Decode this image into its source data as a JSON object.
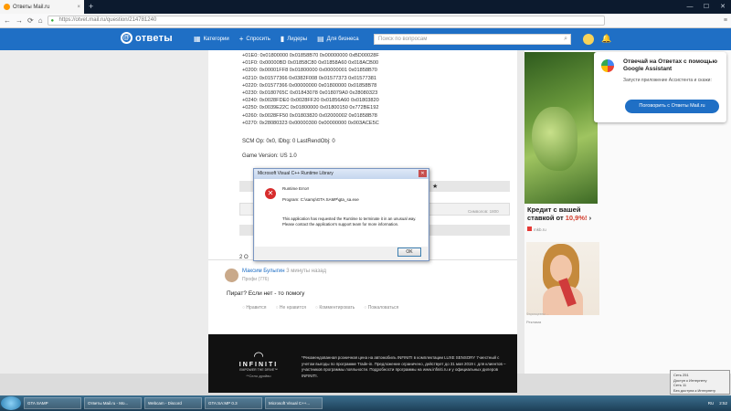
{
  "browser": {
    "tab_title": "Ответы Mail.ru",
    "tab_close": "×",
    "new_tab": "+",
    "url": "https://otvet.mail.ru/question/214781240",
    "win_min": "—",
    "win_max": "☐",
    "win_close": "✕",
    "back": "←",
    "forward": "→",
    "reload": "⟳",
    "home": "⌂",
    "menu": "≡"
  },
  "site": {
    "logo_text": "ответы",
    "menu": [
      {
        "icon": "▦",
        "label": "Категории"
      },
      {
        "icon": "+",
        "label": "Спросить"
      },
      {
        "icon": "▮",
        "label": "Лидеры"
      },
      {
        "icon": "▤",
        "label": "Для бизнеса"
      }
    ],
    "search_placeholder": "Поиск по вопросам",
    "bell": "🔔"
  },
  "question": {
    "dump_lines": [
      "+01E0: 0x01800000 0x01858B70 0x00000000 0xBD00028F",
      "+01F0: 0x00000BD 0x01858C80 0x01858A60 0x018ACB00",
      "+0200: 0x00001FF8 0x01800000 0x00000001 0x01858B70",
      "+0210: 0x01577366 0x0382F008 0x01577373 0x01577381",
      "+0220: 0x01577366 0x00000000 0x01800000 0x01858B78",
      "+0230: 0x0180765C 0x01843078 0x018079A0 0x28080323",
      "+0240: 0x0028FDE0 0x0028FF20 0x01856A60 0x01803820",
      "+0250: 0x0039E22C 0x01800000 0x01800150 0x772BE192",
      "+0260: 0x0028FF50 0x01803820 0x02000002 0x01858B78",
      "+0270: 0x28080323 0x00000300 0x00000000 0x003ACE5C"
    ],
    "scm": "SCM Op: 0x0, lDbg: 0 LastRendObj: 0",
    "game_version": "Game Version: US 1.0",
    "star": "★",
    "counter": "Символов: 1800",
    "answers_count": "2 О"
  },
  "answer": {
    "author": "Максим Булыгин",
    "time": "3 минуты назад",
    "rank": "Профи (776)",
    "text": "Пират? Если нет - то помогу",
    "actions": [
      "Нравится",
      "Не нравится",
      "Комментировать",
      "Пожаловаться"
    ]
  },
  "ad_infiniti": {
    "mark": "◠",
    "brand": "INFINITI",
    "tagline": "EMPOWER THE DRIVE™",
    "sub": "**Село дройво",
    "text": "*Рекомендованная розничная цена на автомобиль INFINITI в комплектации LUXE SENSORY 7-местный с учетом выгоды по программе Trade-in. Предложение ограничено, действует до 31 мая 2019 г. для клиентов – участников программы лояльности. Подробности программы на www.infiniti.ru и у официальных дилеров INFINITI."
  },
  "assistant_popup": {
    "title": "Отвечай на Ответах с помощью Google Assistant",
    "subtitle": "Запусти приложение Ассистента и скажи:",
    "button": "Поговорить с Ответы Mail.ru"
  },
  "ad_credit": {
    "line1": "Кредит с вашей",
    "line2_pre": "ставкой от ",
    "rate": "10,9%!",
    "chevron": " ›",
    "source": "mkb.ru",
    "woman_caption": "Фармацевты ...",
    "label": "Реклама"
  },
  "dialog": {
    "title": "Microsoft Visual C++ Runtime Library",
    "error_heading": "Runtime Error!",
    "program": "Program: C:\\samp\\GTA SAMP\\gta_sa.exe",
    "message": "This application has requested the Runtime to terminate it in an unusual way. Please contact the application's support team for more information.",
    "ok": "OK",
    "close": "✕",
    "err_glyph": "✕"
  },
  "taskbar": {
    "buttons": [
      "GTA SAMP",
      "Ответы Mail.ru - Mo...",
      "Webcam - Discord",
      "GTA:SA:MP 0.3",
      "Microsoft Visual C++..."
    ],
    "lang": "RU",
    "time": "2:52"
  },
  "notification": {
    "line1": "Сеть 251",
    "line2": "Доступ к Интернету",
    "line3": "Сеть 11",
    "line4": "Без доступа к Интернету"
  },
  "colors": {
    "brand_blue": "#1f6fc5",
    "error_red": "#d72c2c",
    "rate_red": "#d23a2a"
  }
}
